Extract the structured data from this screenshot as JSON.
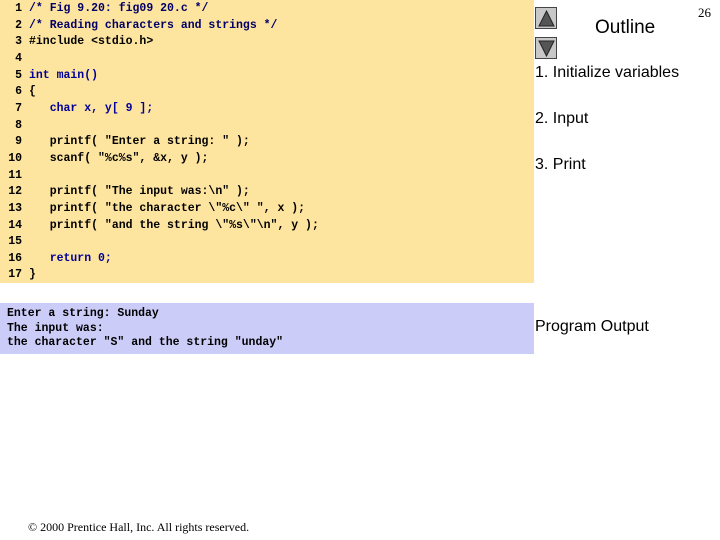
{
  "slide": {
    "page_number": "26",
    "outline_title": "Outline",
    "copyright": "© 2000 Prentice Hall, Inc. All rights reserved."
  },
  "nav": {
    "up_icon": "triangle-up-icon",
    "down_icon": "triangle-down-icon"
  },
  "code": {
    "lines": [
      {
        "n": "1",
        "t": "/* Fig 9.20: fig09 20.c */"
      },
      {
        "n": "2",
        "t": "/* Reading characters and strings */"
      },
      {
        "n": "3",
        "t": "#include <stdio.h>"
      },
      {
        "n": "4",
        "t": ""
      },
      {
        "n": "5",
        "t": "int main()"
      },
      {
        "n": "6",
        "t": "{"
      },
      {
        "n": "7",
        "t": "   char x, y[ 9 ];"
      },
      {
        "n": "8",
        "t": ""
      },
      {
        "n": "9",
        "t": "   printf( \"Enter a string: \" );"
      },
      {
        "n": "10",
        "t": "   scanf( \"%c%s\", &x, y );"
      },
      {
        "n": "11",
        "t": ""
      },
      {
        "n": "12",
        "t": "   printf( \"The input was:\\n\" );"
      },
      {
        "n": "13",
        "t": "   printf( \"the character \\\"%c\\\" \", x );"
      },
      {
        "n": "14",
        "t": "   printf( \"and the string \\\"%s\\\"\\n\", y );"
      },
      {
        "n": "15",
        "t": ""
      },
      {
        "n": "16",
        "t": "   return 0;"
      },
      {
        "n": "17",
        "t": "}"
      }
    ]
  },
  "output": {
    "lines": [
      "Enter a string: Sunday",
      "The input was:",
      "the character \"S\" and the string \"unday\""
    ]
  },
  "outline_items": [
    "1. Initialize variables",
    "2. Input",
    "3. Print",
    "Program Output"
  ],
  "colors": {
    "code_bg": "#fde49f",
    "output_bg": "#ccccf8",
    "comment": "#000066",
    "keyword": "#000099"
  }
}
